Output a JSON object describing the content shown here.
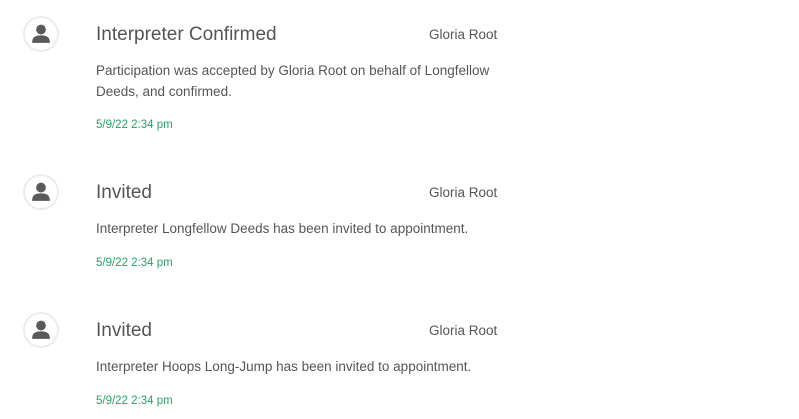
{
  "activities": [
    {
      "title": "Interpreter Confirmed",
      "user": "Gloria Root",
      "description": "Participation was accepted by Gloria Root on behalf of Longfellow Deeds, and confirmed.",
      "timestamp": "5/9/22 2:34 pm",
      "avatar_icon": "user-icon"
    },
    {
      "title": "Invited",
      "user": "Gloria Root",
      "description": "Interpreter Longfellow Deeds has been invited to appointment.",
      "timestamp": "5/9/22 2:34 pm",
      "avatar_icon": "user-icon"
    },
    {
      "title": "Invited",
      "user": "Gloria Root",
      "description": "Interpreter Hoops Long-Jump has been invited to appointment.",
      "timestamp": "5/9/22 2:34 pm",
      "avatar_icon": "user-icon"
    }
  ],
  "colors": {
    "text": "#555555",
    "timestamp": "#2aa06a",
    "avatar_icon": "#5a5a5a",
    "avatar_border": "#ececec"
  }
}
